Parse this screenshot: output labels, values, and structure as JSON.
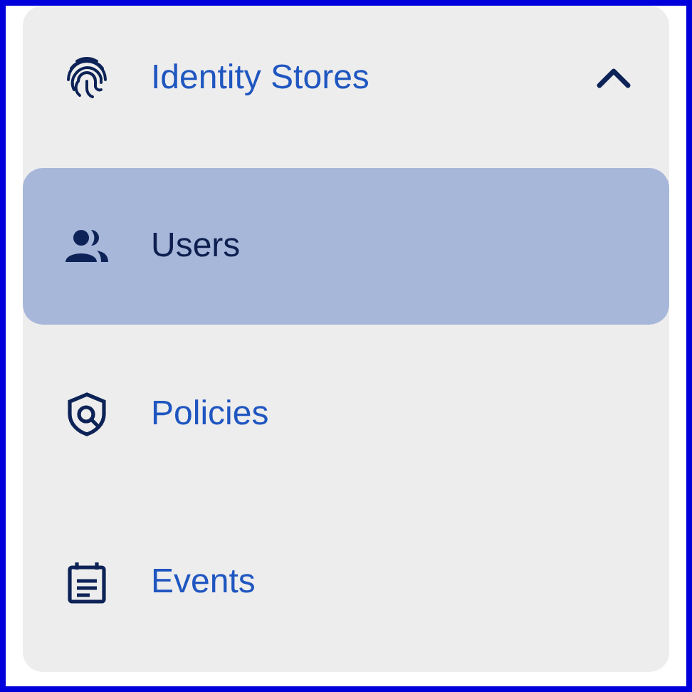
{
  "nav_group": {
    "label": "Identity Stores",
    "kind": "fingerprint",
    "expanded": true
  },
  "items": [
    {
      "label": "Users",
      "kind": "people",
      "selected": true
    },
    {
      "label": "Policies",
      "kind": "shield",
      "selected": false
    },
    {
      "label": "Events",
      "kind": "calendar",
      "selected": false
    }
  ]
}
